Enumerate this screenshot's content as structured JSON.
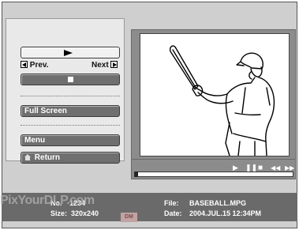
{
  "player": {
    "prev_label": "Prev.",
    "next_label": "Next",
    "fullscreen_label": "Full Screen",
    "menu_label": "Menu",
    "return_label": "Return"
  },
  "info": {
    "no_label": "No.",
    "no_value": "1234",
    "size_label": "Size:",
    "size_value": "320x240",
    "file_label": "File:",
    "file_value": "BASEBALL.MPG",
    "date_label": "Date:",
    "date_value": "2004.JUL.15 12:34PM"
  },
  "playback": {
    "progress_fraction": 0.0
  },
  "watermark": {
    "text": "PixYourDLP.com",
    "badge": "DM"
  },
  "icons": {
    "play": "play-icon",
    "stop": "stop-icon",
    "prev": "arrow-left-icon",
    "next": "arrow-right-icon",
    "home": "home-icon",
    "pause": "pause-icon",
    "rewind": "rewind-icon",
    "forward": "fast-forward-icon"
  }
}
